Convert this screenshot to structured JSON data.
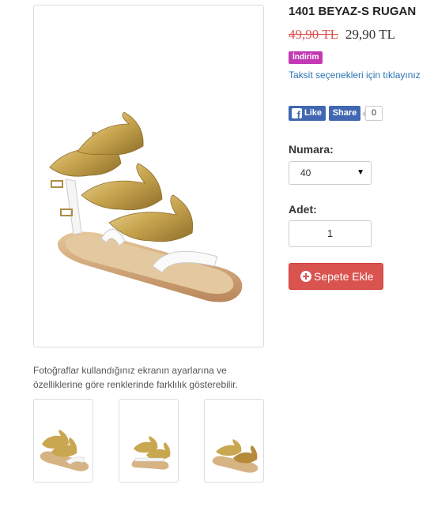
{
  "product": {
    "title": "1401 BEYAZ-S RUGAN",
    "old_price": "49,90 TL",
    "new_price": "29,90 TL",
    "badge": "İndirim",
    "installment_link": "Taksit seçenekleri için tıklayınız"
  },
  "social": {
    "like_label": "Like",
    "share_label": "Share",
    "count": "0"
  },
  "options": {
    "size_label": "Numara:",
    "size_value": "40",
    "qty_label": "Adet:",
    "qty_value": "1",
    "cart_label": "Sepete Ekle"
  },
  "gallery": {
    "note": "Fotoğraflar kullandığınız ekranın ayarlarına ve özelliklerine göre renklerinde farklılık gösterebilir.",
    "thumb_count": 3
  },
  "colors": {
    "sale_red": "#d9534f",
    "badge_magenta": "#c239b3",
    "link_blue": "#2a74b5",
    "facebook_blue": "#4267b2",
    "gold": "#c9a650"
  }
}
